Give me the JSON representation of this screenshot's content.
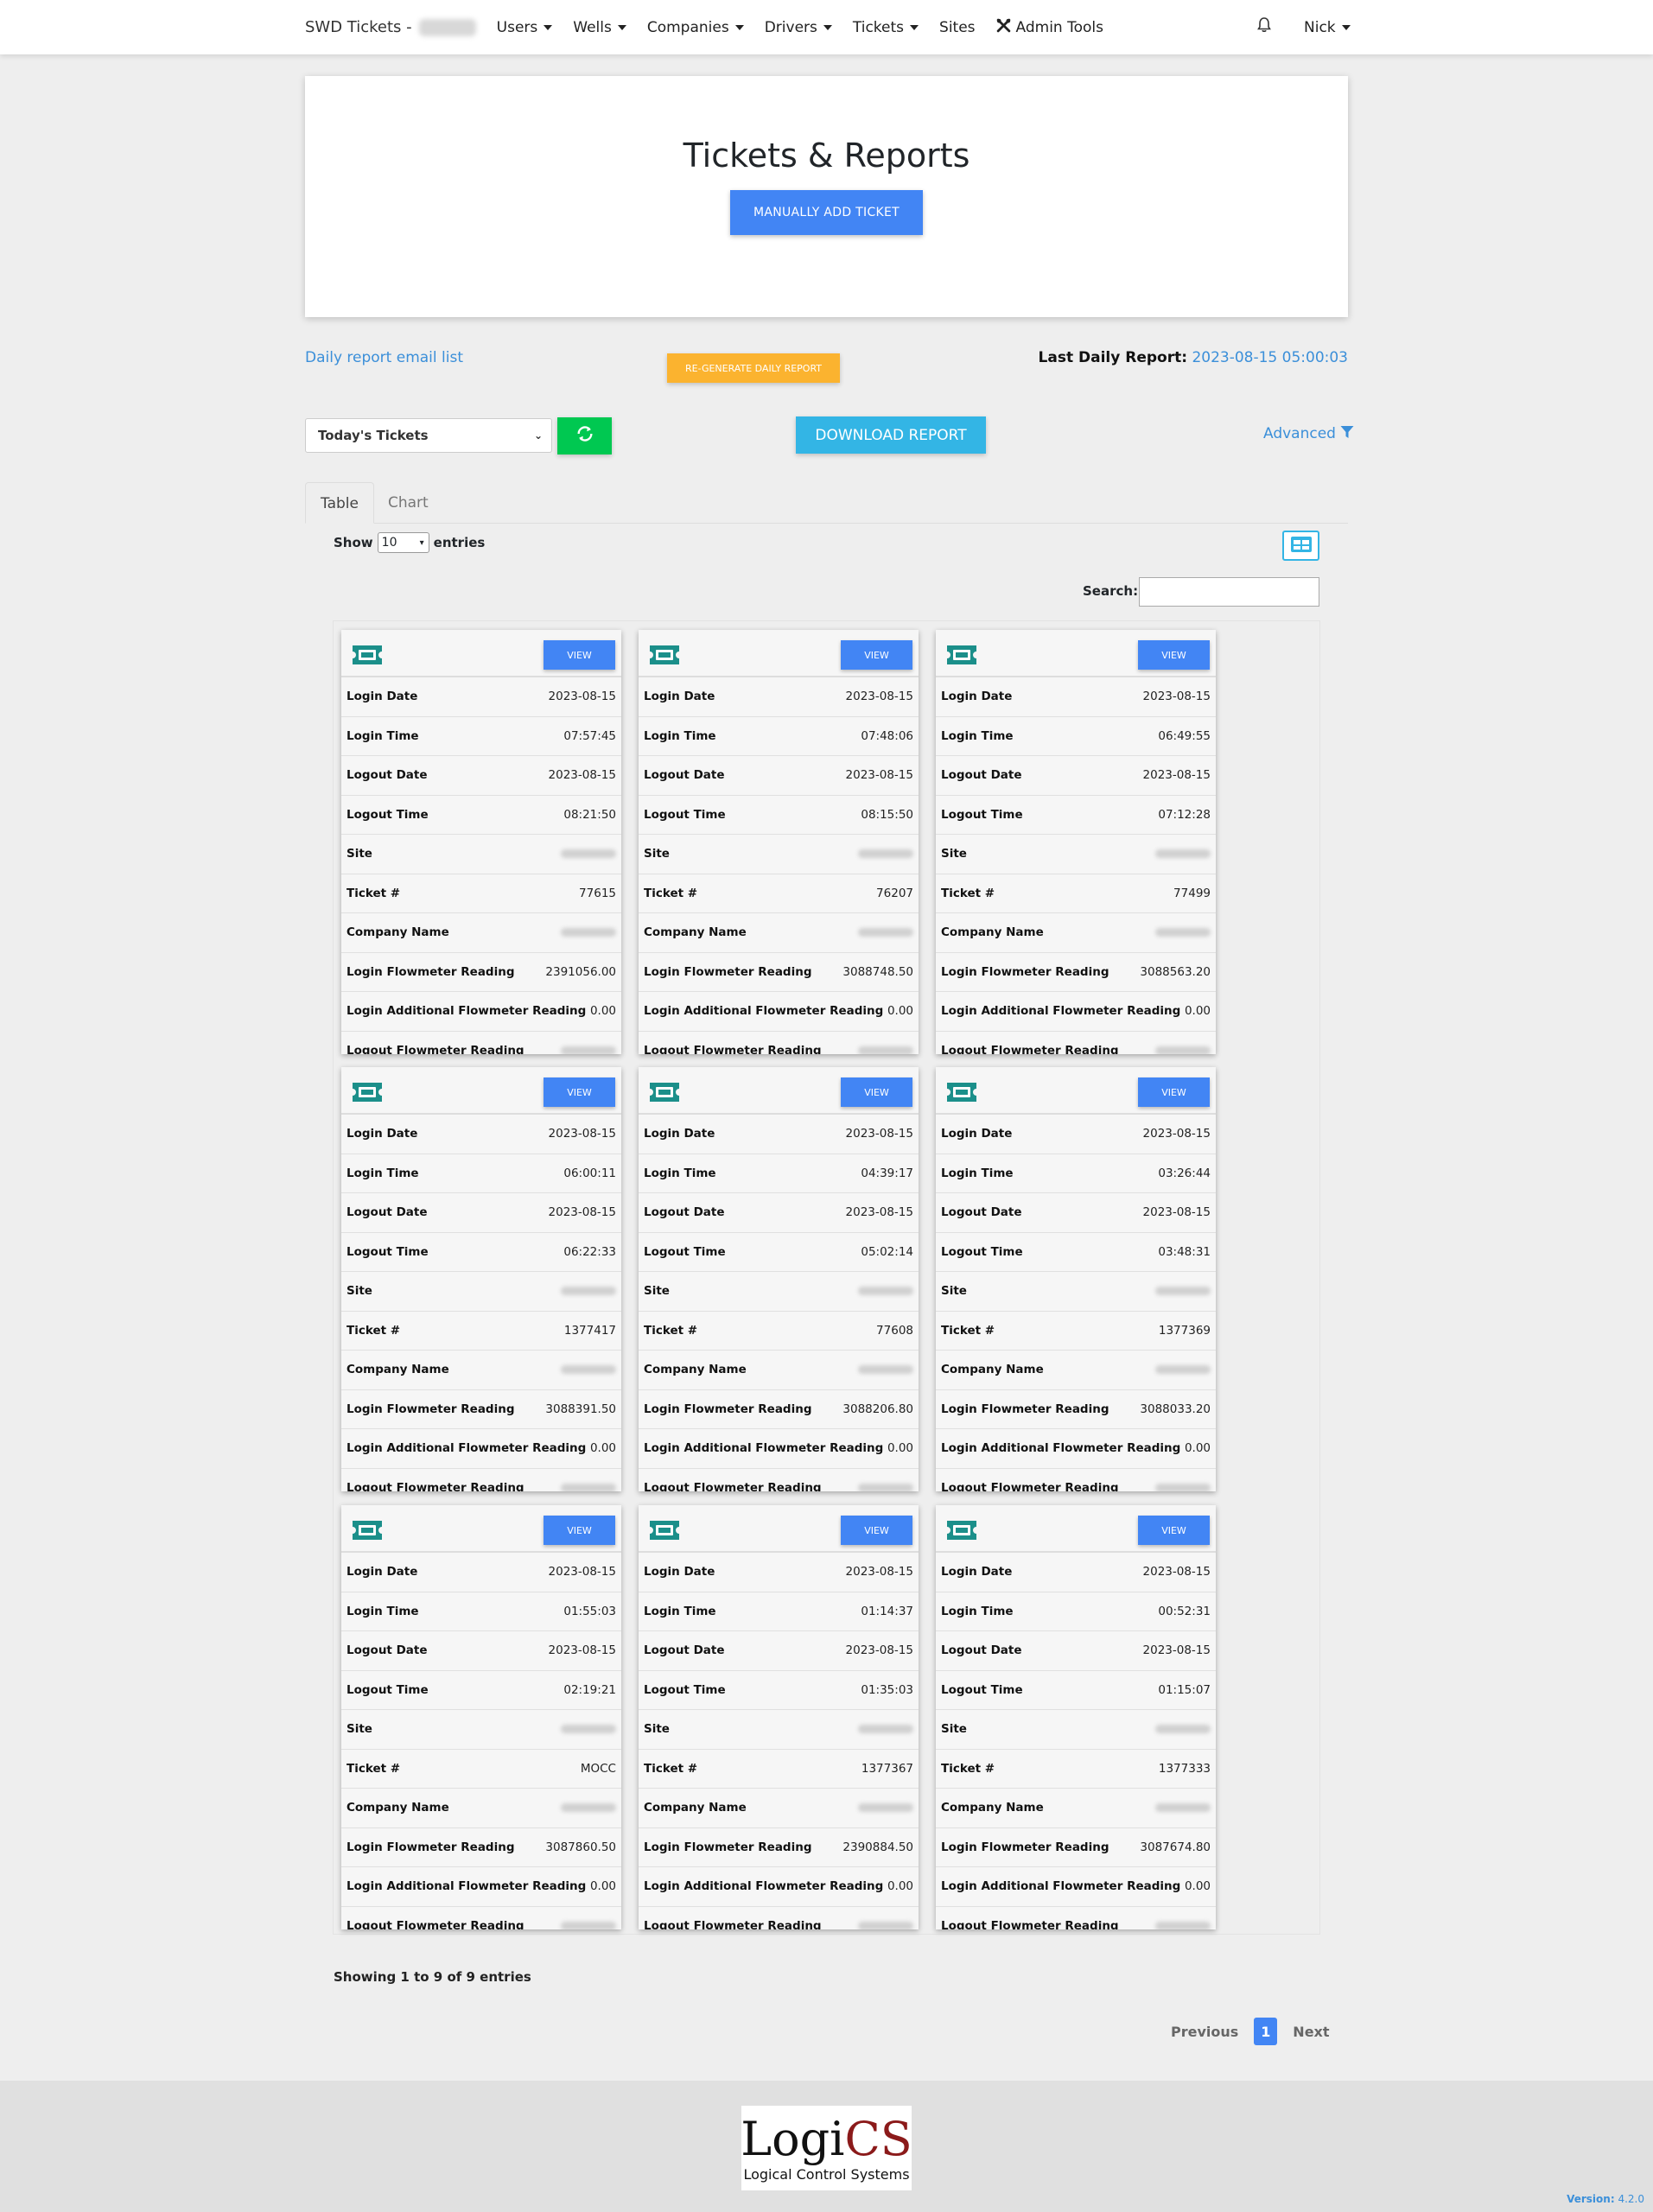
{
  "nav": {
    "brand": "SWD Tickets -",
    "items": [
      {
        "label": "Users",
        "dropdown": true
      },
      {
        "label": "Wells",
        "dropdown": true
      },
      {
        "label": "Companies",
        "dropdown": true
      },
      {
        "label": "Drivers",
        "dropdown": true
      },
      {
        "label": "Tickets",
        "dropdown": true
      },
      {
        "label": "Sites",
        "dropdown": false
      }
    ],
    "admin_tools": "Admin Tools",
    "user": "Nick"
  },
  "hero": {
    "title": "Tickets & Reports",
    "add_button": "MANUALLY ADD TICKET"
  },
  "report": {
    "email_list_link": "Daily report email list",
    "regenerate_button": "RE-GENERATE DAILY REPORT",
    "last_label": "Last Daily Report:",
    "last_value": "2023-08-15 05:00:03"
  },
  "filters": {
    "selected_range": "Today's Tickets",
    "download_button": "DOWNLOAD REPORT",
    "advanced_link": "Advanced"
  },
  "tabs": [
    "Table",
    "Chart"
  ],
  "table": {
    "show_label": "Show",
    "entries_value": "10",
    "entries_label": "entries",
    "search_label": "Search:",
    "search_value": "",
    "info": "Showing 1 to 9 of 9 entries",
    "prev": "Previous",
    "page": "1",
    "next": "Next"
  },
  "card_labels": {
    "view": "VIEW",
    "login_date": "Login Date",
    "login_time": "Login Time",
    "logout_date": "Logout Date",
    "logout_time": "Logout Time",
    "site": "Site",
    "ticket_no": "Ticket #",
    "company": "Company Name",
    "login_flow": "Login Flowmeter Reading",
    "login_add_flow": "Login Additional Flowmeter Reading",
    "logout_flow": "Logout Flowmeter Reading"
  },
  "tickets": [
    {
      "login_date": "2023-08-15",
      "login_time": "07:57:45",
      "logout_date": "2023-08-15",
      "logout_time": "08:21:50",
      "ticket_no": "77615",
      "login_flow": "2391056.00",
      "login_add_flow": "0.00"
    },
    {
      "login_date": "2023-08-15",
      "login_time": "07:48:06",
      "logout_date": "2023-08-15",
      "logout_time": "08:15:50",
      "ticket_no": "76207",
      "login_flow": "3088748.50",
      "login_add_flow": "0.00"
    },
    {
      "login_date": "2023-08-15",
      "login_time": "06:49:55",
      "logout_date": "2023-08-15",
      "logout_time": "07:12:28",
      "ticket_no": "77499",
      "login_flow": "3088563.20",
      "login_add_flow": "0.00"
    },
    {
      "login_date": "2023-08-15",
      "login_time": "06:00:11",
      "logout_date": "2023-08-15",
      "logout_time": "06:22:33",
      "ticket_no": "1377417",
      "login_flow": "3088391.50",
      "login_add_flow": "0.00"
    },
    {
      "login_date": "2023-08-15",
      "login_time": "04:39:17",
      "logout_date": "2023-08-15",
      "logout_time": "05:02:14",
      "ticket_no": "77608",
      "login_flow": "3088206.80",
      "login_add_flow": "0.00"
    },
    {
      "login_date": "2023-08-15",
      "login_time": "03:26:44",
      "logout_date": "2023-08-15",
      "logout_time": "03:48:31",
      "ticket_no": "1377369",
      "login_flow": "3088033.20",
      "login_add_flow": "0.00"
    },
    {
      "login_date": "2023-08-15",
      "login_time": "01:55:03",
      "logout_date": "2023-08-15",
      "logout_time": "02:19:21",
      "ticket_no": "MOCC",
      "login_flow": "3087860.50",
      "login_add_flow": "0.00"
    },
    {
      "login_date": "2023-08-15",
      "login_time": "01:14:37",
      "logout_date": "2023-08-15",
      "logout_time": "01:35:03",
      "ticket_no": "1377367",
      "login_flow": "2390884.50",
      "login_add_flow": "0.00"
    },
    {
      "login_date": "2023-08-15",
      "login_time": "00:52:31",
      "logout_date": "2023-08-15",
      "logout_time": "01:15:07",
      "ticket_no": "1377333",
      "login_flow": "3087674.80",
      "login_add_flow": "0.00"
    }
  ],
  "footer": {
    "logo_main_a": "Logi",
    "logo_main_b": "CS",
    "logo_sub": "Logical Control Systems",
    "version_label": "Version:",
    "version_value": "4.2.0"
  },
  "colors": {
    "primary": "#4285f4",
    "success": "#00c851",
    "info": "#33b5e5",
    "warning": "#fbb32f",
    "ticket_icon": "#1b8f8a",
    "link": "#3b8fd9"
  },
  "icons": {
    "bell": "bell-icon",
    "tools": "tools-icon",
    "refresh": "refresh-icon",
    "filter": "filter-icon",
    "grid": "grid-view-icon",
    "ticket": "ticket-icon"
  }
}
